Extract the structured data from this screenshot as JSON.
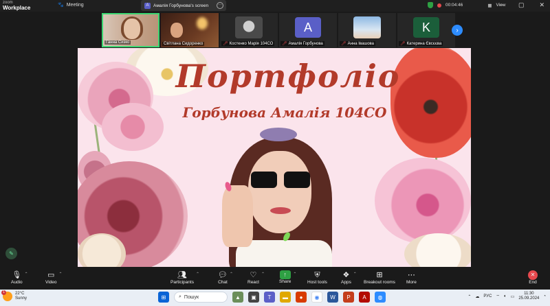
{
  "app": {
    "brand_line1": "zoom",
    "brand_line2": "Workplace",
    "meeting_label": "Meeting"
  },
  "share_pill": {
    "avatar_letter": "A",
    "label": "Амалія Горбунова's screen"
  },
  "top_right": {
    "timer": "00:04:46",
    "view_label": "View"
  },
  "participants": [
    {
      "name": "Ганна Сизко",
      "muted": false,
      "type": "video"
    },
    {
      "name": "Світлана Сидоренко",
      "muted": false,
      "type": "video"
    },
    {
      "name": "Костенко Марія 104СО",
      "muted": true,
      "type": "photo"
    },
    {
      "name": "Амалія Горбунова",
      "muted": true,
      "type": "letter",
      "letter": "A",
      "color": "#5a5fc7"
    },
    {
      "name": "Анна Івашова",
      "muted": true,
      "type": "photo"
    },
    {
      "name": "Катерина Євсєєва",
      "muted": true,
      "type": "letter",
      "letter": "K",
      "color": "#1b5e3a"
    }
  ],
  "slide": {
    "title": "Портфоліо",
    "subtitle": "Горбунова Амалія 104СО"
  },
  "toolbar": {
    "audio": "Audio",
    "video": "Video",
    "participants": "Participants",
    "participants_count": "9",
    "chat": "Chat",
    "react": "React",
    "share": "Share",
    "host_tools": "Host tools",
    "apps": "Apps",
    "breakout": "Breakout rooms",
    "more": "More",
    "end": "End"
  },
  "taskbar": {
    "weather_badge": "1",
    "temperature": "22°C",
    "condition": "Sunny",
    "search_placeholder": "Пошук",
    "language": "РУС",
    "time": "11:30",
    "date": "25.09.2024"
  },
  "colors": {
    "accent": "#2d8cff",
    "active_tile": "#3bd671",
    "title_red": "#b23a2a",
    "slide_bg": "#fbe4ec"
  }
}
